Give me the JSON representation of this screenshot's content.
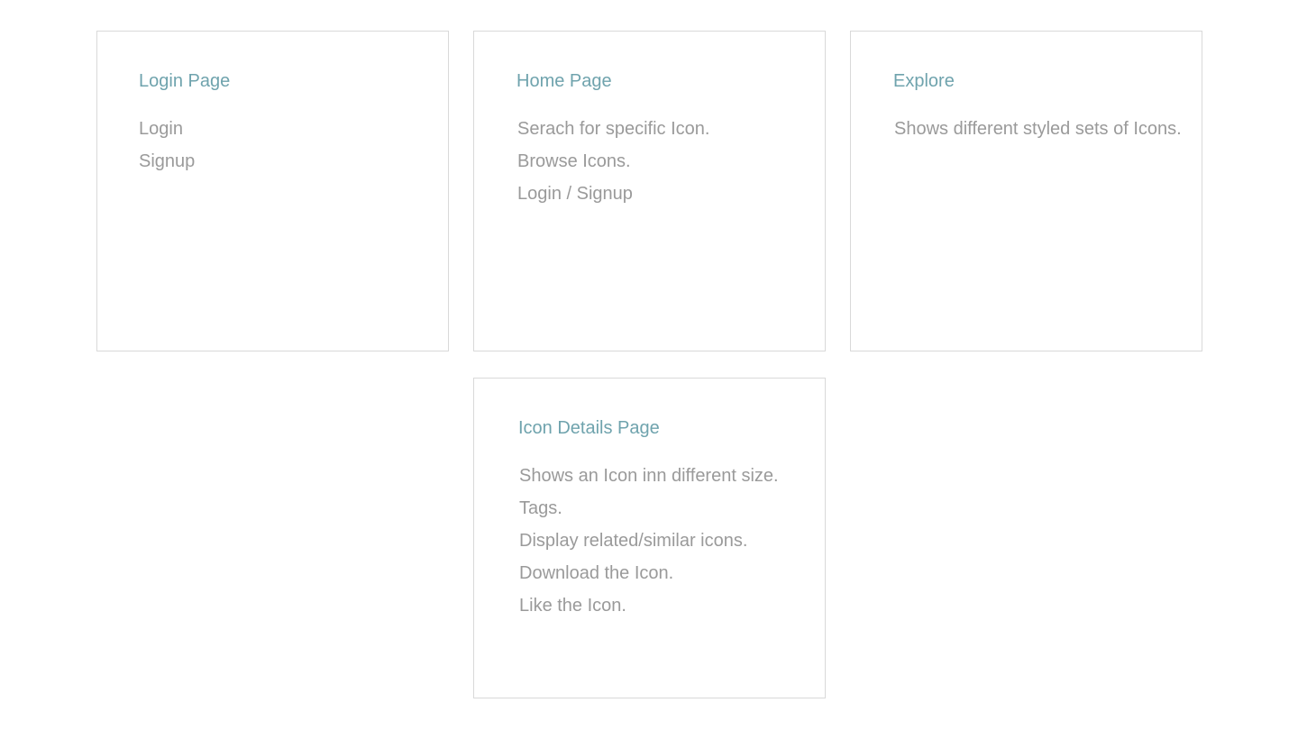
{
  "cards": [
    {
      "title": "Login Page",
      "items": [
        "Login",
        "Signup"
      ]
    },
    {
      "title": "Home Page",
      "items": [
        "Serach for specific Icon.",
        "Browse Icons.",
        "Login / Signup"
      ]
    },
    {
      "title": "Explore",
      "items": [
        "Shows different styled sets of Icons."
      ]
    },
    {
      "title": "Icon Details Page",
      "items": [
        "Shows an Icon inn different size.",
        "Tags.",
        "Display related/similar icons.",
        "Download the Icon.",
        "Like the Icon."
      ]
    }
  ],
  "colors": {
    "title": "#6fa3ad",
    "text": "#9a9a9a",
    "border": "#d9d9d9",
    "background": "#ffffff"
  }
}
